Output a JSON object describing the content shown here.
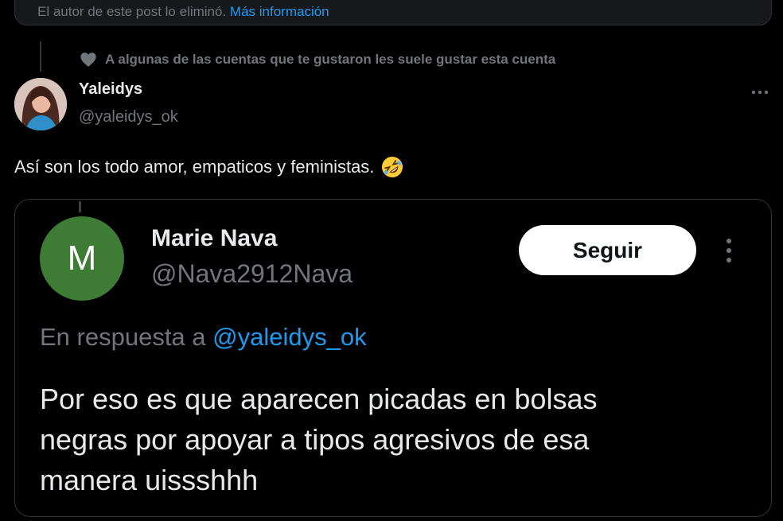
{
  "top_notice": {
    "text": "El autor de este post lo eliminó.",
    "link": "Más información"
  },
  "social_context": {
    "icon": "heart-icon",
    "text": "A algunas de las cuentas que te gustaron les suele gustar esta cuenta"
  },
  "tweet": {
    "author_name": "Yaleidys",
    "author_handle": "@yaleidys_ok",
    "text": "Así son los todo amor, empaticos y feministas.",
    "emoji": "rolling-on-floor-laughing-emoji"
  },
  "quoted": {
    "avatar_letter": "M",
    "avatar_color": "#3e7b34",
    "name": "Marie Nava",
    "handle": "@Nava2912Nava",
    "follow_label": "Seguir",
    "reply_prefix": "En respuesta a",
    "reply_mention": "@yaleidys_ok",
    "text_lines": [
      "Por eso es que aparecen picadas en bolsas",
      "negras por apoyar a tipos agresivos de esa",
      "manera uissshhh"
    ]
  },
  "colors": {
    "background": "#000000",
    "text": "#e7e9ea",
    "muted": "#71767b",
    "link": "#1d9bf0",
    "border": "#2f3336"
  }
}
